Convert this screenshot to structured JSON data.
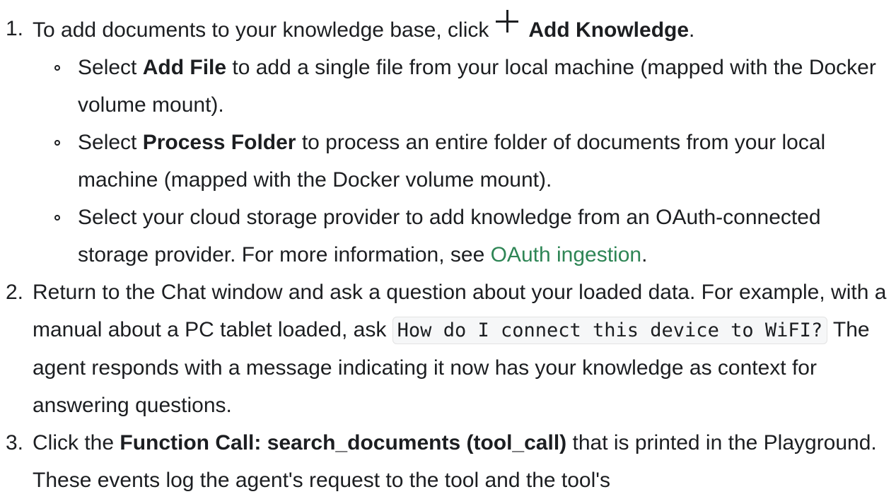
{
  "steps": [
    {
      "number": "1.",
      "text_before": "To add documents to your knowledge base, click",
      "icon": "plus-icon",
      "bold": "Add Knowledge",
      "text_after": ".",
      "options": [
        {
          "prefix": "Select ",
          "bold": "Add File",
          "suffix": " to add a single file from your local machine (mapped with the Docker volume mount)."
        },
        {
          "prefix": "Select ",
          "bold": "Process Folder",
          "suffix": " to process an entire folder of documents from your local machine (mapped with the Docker volume mount)."
        },
        {
          "text": "Select your cloud storage provider to add knowledge from an OAuth-connected storage provider. For more information, see ",
          "link": "OAuth ingestion",
          "suffix": "."
        }
      ]
    },
    {
      "number": "2.",
      "text_before": "Return to the Chat window and ask a question about your loaded data. For example, with a manual about a PC tablet loaded, ask ",
      "code": "How do I connect this device to WiFI?",
      "text_after": " The agent responds with a message indicating it now has your knowledge as context for answering questions."
    },
    {
      "number": "3.",
      "text_before": "Click the ",
      "bold": "Function Call: search_documents (tool_call)",
      "text_after": " that is printed in the Playground. These events log the agent's request to the tool and the tool's"
    }
  ]
}
